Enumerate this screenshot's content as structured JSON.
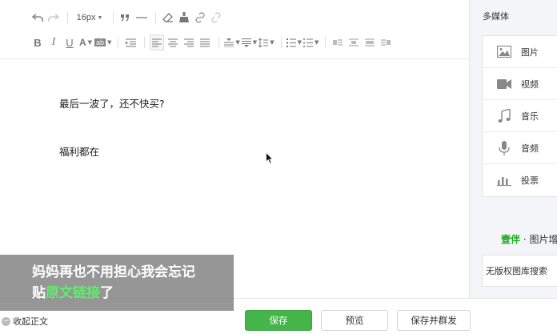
{
  "toolbar": {
    "font_size": "16px",
    "icons_row1": [
      "undo-icon",
      "redo-icon",
      "quote-icon",
      "horizontal-rule-icon",
      "clear-format-icon",
      "format-brush-icon",
      "link-icon",
      "unlink-icon"
    ],
    "icons_row2": [
      "bold-icon",
      "italic-icon",
      "underline-icon",
      "font-color-icon",
      "background-color-icon",
      "indent-icon",
      "align-left-icon",
      "align-center-icon",
      "align-right-icon",
      "justify-icon",
      "line-spacing-before-icon",
      "line-spacing-after-icon",
      "line-height-icon",
      "ordered-list-icon",
      "unordered-list-icon",
      "float-left-icon",
      "float-none-icon",
      "float-center-icon",
      "float-right-icon"
    ],
    "bold": "B",
    "italic": "I",
    "underline": "U",
    "font_color": "A",
    "bg_color": "ab"
  },
  "editor": {
    "paragraphs": [
      "最后一波了，还不快买?",
      "福利都在"
    ]
  },
  "sidebar": {
    "title": "多媒体",
    "media_items": [
      {
        "label": "图片",
        "icon": "image-icon"
      },
      {
        "label": "视频",
        "icon": "video-icon"
      },
      {
        "label": "音乐",
        "icon": "music-icon"
      },
      {
        "label": "音频",
        "icon": "microphone-icon"
      },
      {
        "label": "投票",
        "icon": "poll-icon"
      }
    ],
    "brand_green": "壹伴",
    "brand_dot": "·",
    "brand_rest": "图片增",
    "stock_label": "无版权图库搜索"
  },
  "bottom": {
    "collapse_label": "收起正文",
    "save_label": "保存",
    "preview_label": "预览",
    "publish_label": "保存并群发"
  },
  "caption": {
    "line1": "妈妈再也不用担心我会忘记",
    "line2_pre": "贴",
    "line2_highlight": "原文链接",
    "line2_post": "了"
  },
  "colors": {
    "accent_green": "#44b549",
    "brand_green": "#1aad19",
    "caption_highlight": "#5cf067"
  }
}
